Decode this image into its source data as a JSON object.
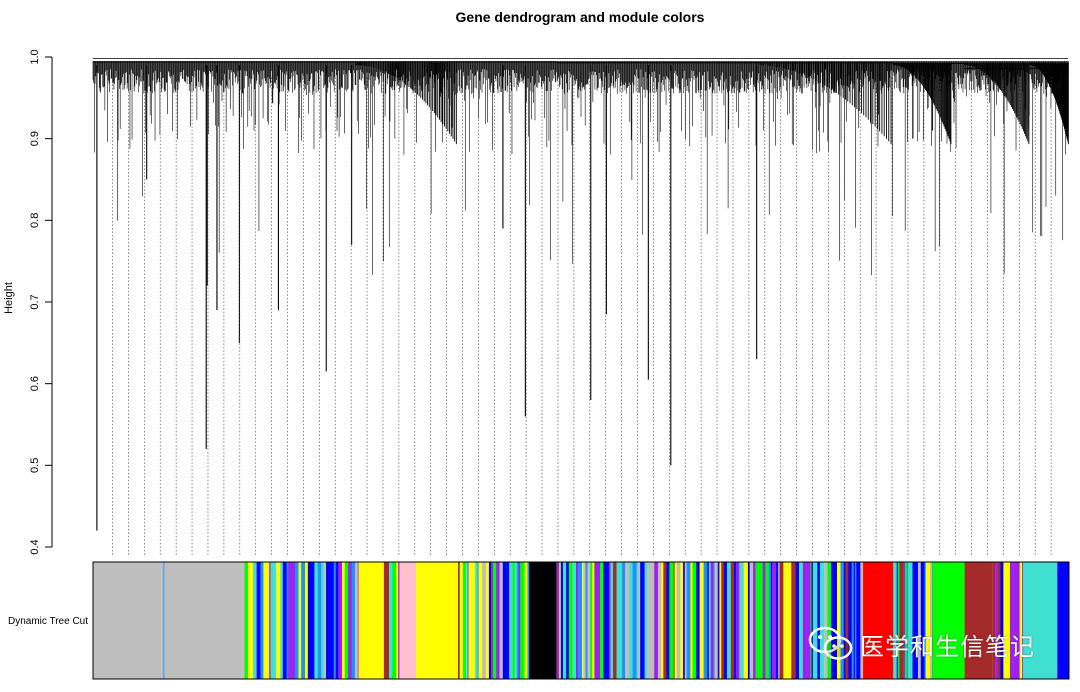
{
  "chart_data": {
    "type": "dendrogram",
    "title": "Gene dendrogram and module colors",
    "ylabel": "Height",
    "xlabel": "",
    "ylim": [
      0.4,
      1.0
    ],
    "yticks": [
      "0.4",
      "0.5",
      "0.6",
      "0.7",
      "0.8",
      "0.9",
      "1.0"
    ],
    "ytick_values": [
      0.4,
      0.5,
      0.6,
      0.7,
      0.8,
      0.9,
      1.0
    ],
    "color_row_label": "Dynamic Tree Cut",
    "module_colors": {
      "grey": "#BEBEBE",
      "turquoise": "#40E0D0",
      "blue": "#0000FF",
      "brown": "#A52A2A",
      "yellow": "#FFFF00",
      "green": "#00FF00",
      "red": "#FF0000",
      "black": "#000000",
      "pink": "#FFC0CB",
      "purple": "#A020F0",
      "lightblue": "#1E90FF"
    },
    "module_blocks": [
      {
        "module": "grey",
        "start": 0.0,
        "end": 0.072
      },
      {
        "module": "mixed",
        "start": 0.072,
        "end": 0.073
      },
      {
        "module": "grey",
        "start": 0.073,
        "end": 0.152
      },
      {
        "module": "mixed",
        "start": 0.152,
        "end": 0.272
      },
      {
        "module": "yellow",
        "start": 0.272,
        "end": 0.298
      },
      {
        "module": "mixed",
        "start": 0.298,
        "end": 0.314
      },
      {
        "module": "pink",
        "start": 0.314,
        "end": 0.331
      },
      {
        "module": "yellow",
        "start": 0.331,
        "end": 0.374
      },
      {
        "module": "mixed",
        "start": 0.374,
        "end": 0.447
      },
      {
        "module": "black",
        "start": 0.447,
        "end": 0.475
      },
      {
        "module": "mixed",
        "start": 0.475,
        "end": 0.789
      },
      {
        "module": "red",
        "start": 0.789,
        "end": 0.82
      },
      {
        "module": "mixed",
        "start": 0.82,
        "end": 0.86
      },
      {
        "module": "green",
        "start": 0.86,
        "end": 0.893
      },
      {
        "module": "brown",
        "start": 0.893,
        "end": 0.922
      },
      {
        "module": "mixed",
        "start": 0.922,
        "end": 0.953
      },
      {
        "module": "turquoise",
        "start": 0.953,
        "end": 0.988
      },
      {
        "module": "blue",
        "start": 0.988,
        "end": 1.0
      }
    ]
  },
  "watermark": {
    "text": "医学和生信笔记",
    "icon": "wechat-icon"
  }
}
